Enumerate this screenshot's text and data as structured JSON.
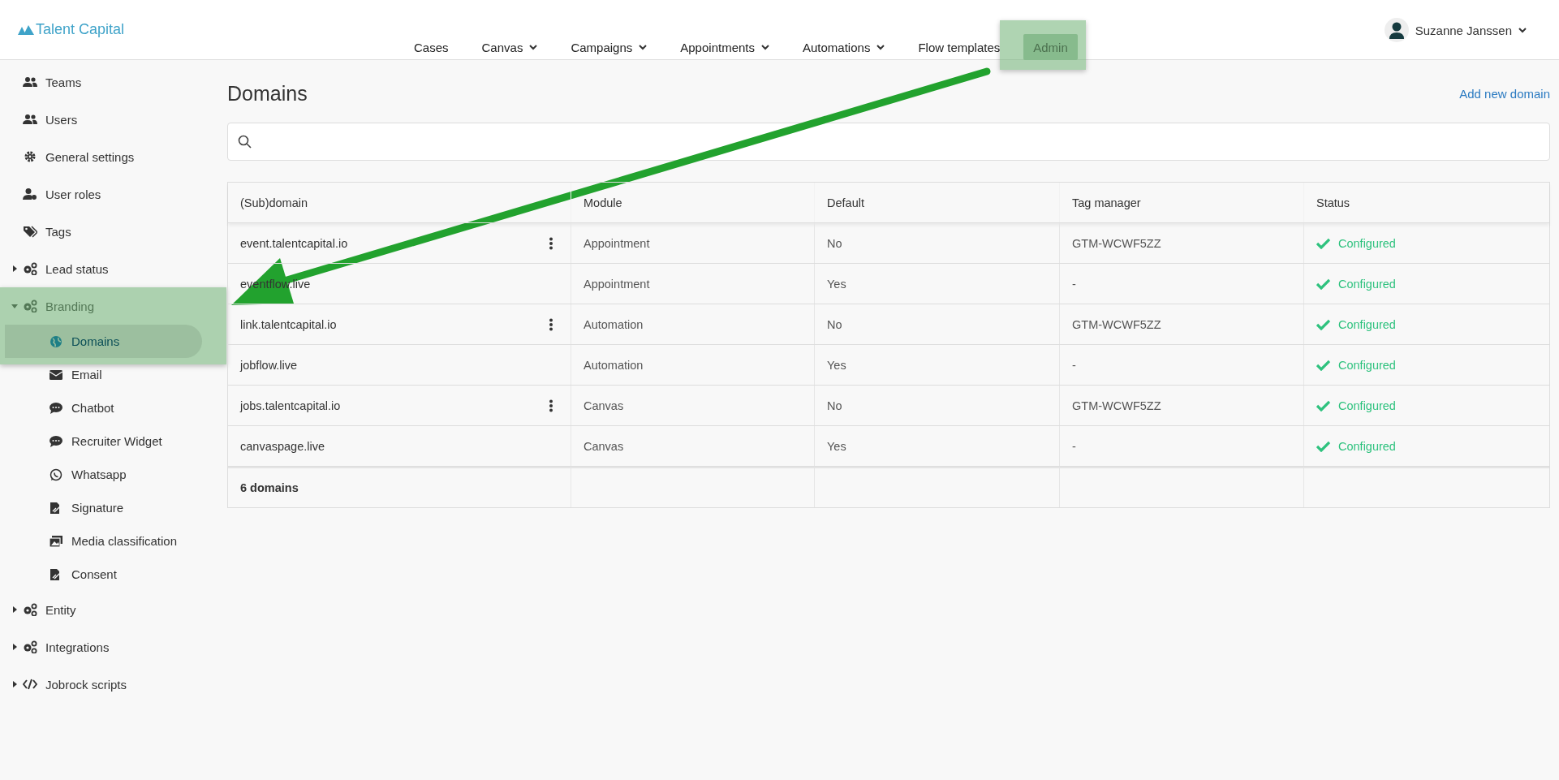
{
  "header": {
    "logo": "Talent Capital",
    "nav": [
      {
        "label": "Cases",
        "dropdown": false,
        "selected": false
      },
      {
        "label": "Canvas",
        "dropdown": true,
        "selected": false
      },
      {
        "label": "Campaigns",
        "dropdown": true,
        "selected": false
      },
      {
        "label": "Appointments",
        "dropdown": true,
        "selected": false
      },
      {
        "label": "Automations",
        "dropdown": true,
        "selected": false
      },
      {
        "label": "Flow templates",
        "dropdown": false,
        "selected": false
      },
      {
        "label": "Admin",
        "dropdown": false,
        "selected": true
      }
    ],
    "user": {
      "name": "Suzanne Janssen"
    }
  },
  "sidebar": {
    "items": [
      {
        "label": "Teams",
        "selected": false
      },
      {
        "label": "Users",
        "selected": false
      },
      {
        "label": "General settings",
        "selected": false
      },
      {
        "label": "User roles",
        "selected": false
      },
      {
        "label": "Tags",
        "selected": false
      },
      {
        "label": "Lead status",
        "selected": false,
        "expanded": false
      },
      {
        "label": "Branding",
        "selected": false,
        "expanded": true,
        "children": [
          {
            "label": "Domains",
            "selected": true
          },
          {
            "label": "Email",
            "selected": false
          },
          {
            "label": "Chatbot",
            "selected": false
          },
          {
            "label": "Recruiter Widget",
            "selected": false
          },
          {
            "label": "Whatsapp",
            "selected": false
          },
          {
            "label": "Signature",
            "selected": false
          },
          {
            "label": "Media classification",
            "selected": false
          },
          {
            "label": "Consent",
            "selected": false
          }
        ]
      },
      {
        "label": "Entity",
        "selected": false,
        "expanded": false
      },
      {
        "label": "Integrations",
        "selected": false,
        "expanded": false
      },
      {
        "label": "Jobrock scripts",
        "selected": false,
        "expanded": false
      }
    ]
  },
  "page": {
    "title": "Domains",
    "add_link": "Add new domain"
  },
  "table": {
    "columns": [
      "(Sub)domain",
      "Module",
      "Default",
      "Tag manager",
      "Status"
    ],
    "rows": [
      {
        "domain": "event.talentcapital.io",
        "menu": true,
        "module": "Appointment",
        "default": "No",
        "tag_manager": "GTM-WCWF5ZZ",
        "status": "Configured",
        "status_ok": true
      },
      {
        "domain": "eventflow.live",
        "menu": false,
        "module": "Appointment",
        "default": "Yes",
        "tag_manager": "-",
        "status": "Configured",
        "status_ok": true
      },
      {
        "domain": "link.talentcapital.io",
        "menu": true,
        "module": "Automation",
        "default": "No",
        "tag_manager": "GTM-WCWF5ZZ",
        "status": "Configured",
        "status_ok": true
      },
      {
        "domain": "jobflow.live",
        "menu": false,
        "module": "Automation",
        "default": "Yes",
        "tag_manager": "-",
        "status": "Configured",
        "status_ok": true
      },
      {
        "domain": "jobs.talentcapital.io",
        "menu": true,
        "module": "Canvas",
        "default": "No",
        "tag_manager": "GTM-WCWF5ZZ",
        "status": "Configured",
        "status_ok": true
      },
      {
        "domain": "canvaspage.live",
        "menu": false,
        "module": "Canvas",
        "default": "Yes",
        "tag_manager": "-",
        "status": "Configured",
        "status_ok": true
      }
    ],
    "footer": "6 domains"
  }
}
